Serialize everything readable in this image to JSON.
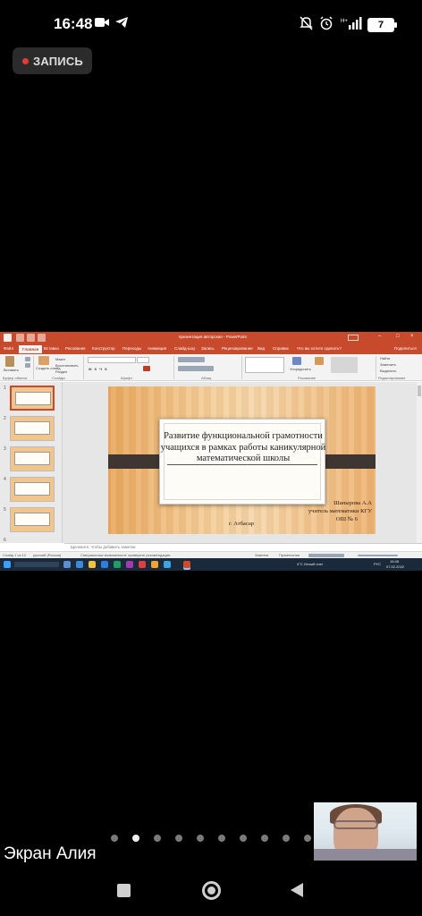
{
  "status_bar": {
    "time": "16:48",
    "battery": "7",
    "icons": [
      "video-camera-icon",
      "telegram-icon",
      "mute-icon",
      "alarm-icon",
      "signal-icon"
    ]
  },
  "recording": {
    "label": "ЗАПИСЬ",
    "color": "#e53935"
  },
  "shared_screen": {
    "window_title": "презентация авторская - PowerPoint",
    "ribbon_tabs": [
      "Файл",
      "Главная",
      "Вставка",
      "Рисование",
      "Конструктор",
      "Переходы",
      "Анимация",
      "Слайд-шоу",
      "Запись",
      "Рецензирование",
      "Вид",
      "Справка",
      "Что вы хотите сделать?",
      "Поделиться"
    ],
    "active_tab": "Главная",
    "ribbon_groups": [
      "Буфер обмена",
      "Слайды",
      "Шрифт",
      "Абзац",
      "Рисование",
      "Редактирование"
    ],
    "ribbon_labels": {
      "paste": "Вставить",
      "new_slide": "Создать слайд",
      "layout": "Макет",
      "reset": "Восстановить",
      "section": "Раздел",
      "arrange": "Упорядочить",
      "find": "Найти",
      "replace": "Заменить",
      "select": "Выделить"
    },
    "slide_count": 6,
    "slide": {
      "title": "Развитие функциональной грамотности учащихся в рамках работы каникулярной математической школы",
      "author_lines": [
        "Шанырова А.А",
        "учитель математики КГУ",
        "ОШ № 6"
      ],
      "city": "г. Атбасар"
    },
    "notes_placeholder": "Щелкните, чтобы добавить заметки",
    "status": {
      "slide_info": "Слайд 1 из 12",
      "language": "русский (Россия)",
      "accessibility": "Специальные возможности: проверьте рекомендации",
      "notes_btn": "Заметки",
      "comments_btn": "Примечания"
    },
    "taskbar": {
      "weather": "4°C Легкий снег",
      "lang": "РУС",
      "time": "16:48",
      "date": "07.02.2022"
    }
  },
  "pager": {
    "count": 10,
    "active_index": 1
  },
  "speaker_label": "Экран Алия",
  "nav": [
    "recents-button",
    "home-button",
    "back-button"
  ]
}
